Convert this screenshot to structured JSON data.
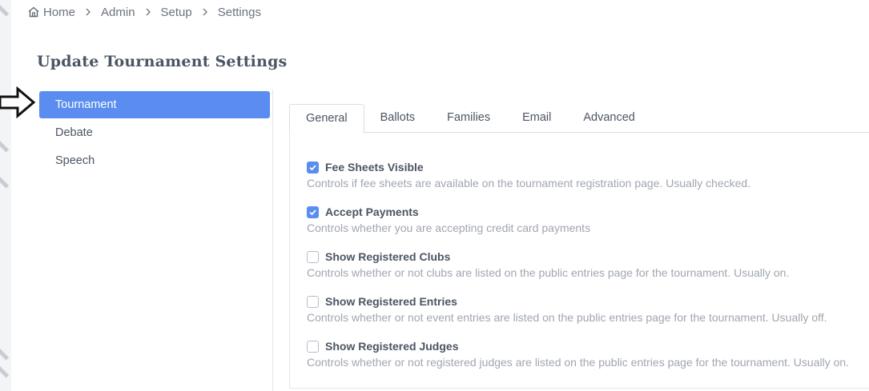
{
  "breadcrumb": {
    "items": [
      "Home",
      "Admin",
      "Setup",
      "Settings"
    ]
  },
  "page_title": "Update Tournament Settings",
  "sidenav": {
    "items": [
      {
        "label": "Tournament",
        "active": true
      },
      {
        "label": "Debate",
        "active": false
      },
      {
        "label": "Speech",
        "active": false
      }
    ]
  },
  "tabs": [
    {
      "label": "General",
      "active": true
    },
    {
      "label": "Ballots",
      "active": false
    },
    {
      "label": "Families",
      "active": false
    },
    {
      "label": "Email",
      "active": false
    },
    {
      "label": "Advanced",
      "active": false
    }
  ],
  "settings": [
    {
      "label": "Fee Sheets Visible",
      "checked": true,
      "description": "Controls if fee sheets are available on the tournament registration page. Usually checked."
    },
    {
      "label": "Accept Payments",
      "checked": true,
      "description": "Controls whether you are accepting credit card payments"
    },
    {
      "label": "Show Registered Clubs",
      "checked": false,
      "description": "Controls whether or not clubs are listed on the public entries page for the tournament. Usually on."
    },
    {
      "label": "Show Registered Entries",
      "checked": false,
      "description": "Controls whether or not event entries are listed on the public entries page for the tournament. Usually off."
    },
    {
      "label": "Show Registered Judges",
      "checked": false,
      "description": "Controls whether or not registered judges are listed on the public entries page for the tournament. Usually on."
    }
  ],
  "colors": {
    "accent": "#5a8def",
    "text": "#4b5563",
    "muted": "#a0a6b0"
  },
  "icons": [
    "home-icon",
    "chevron-right-icon",
    "check-icon",
    "arrow-right-outline-icon"
  ]
}
